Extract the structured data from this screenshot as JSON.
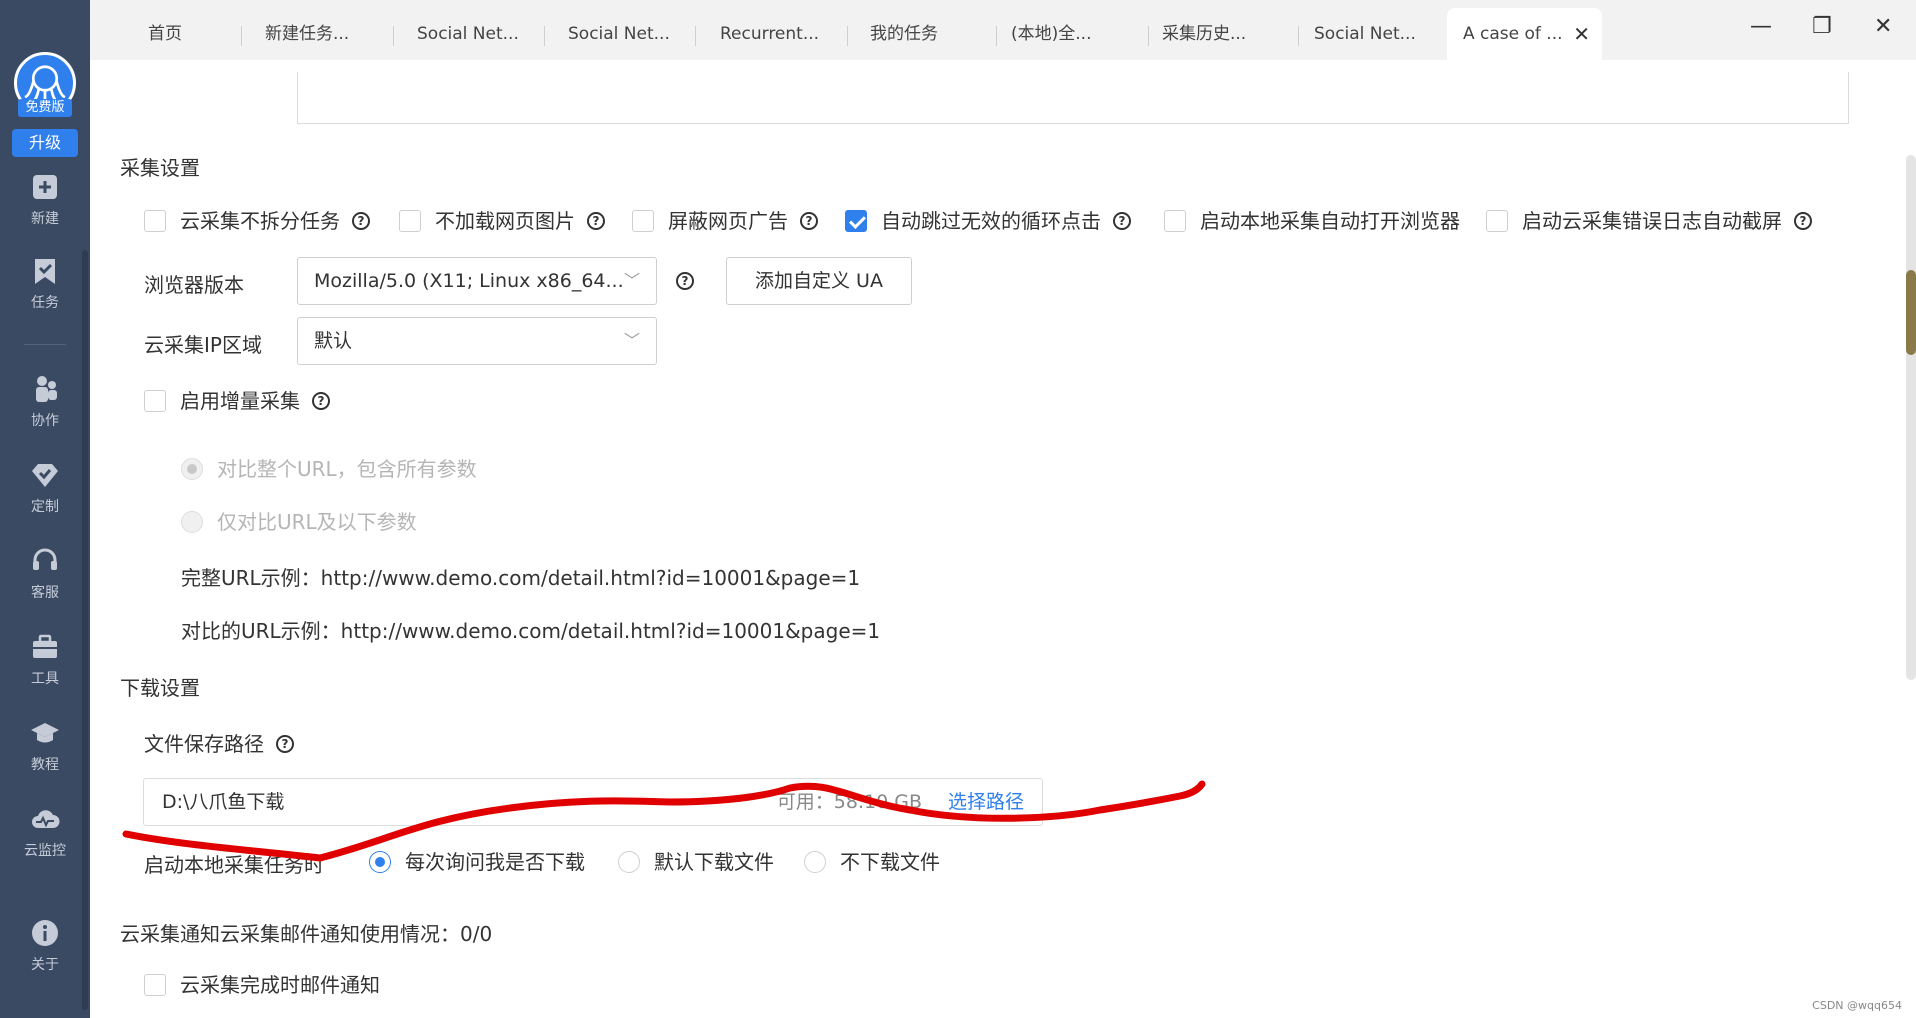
{
  "sidebar": {
    "free_badge": "免费版",
    "upgrade": "升级",
    "items": [
      {
        "label": "新建",
        "icon": "plus-square-icon"
      },
      {
        "label": "任务",
        "icon": "bookmark-check-icon"
      },
      {
        "label": "协作",
        "icon": "users-icon"
      },
      {
        "label": "定制",
        "icon": "diamond-check-icon"
      },
      {
        "label": "客服",
        "icon": "headset-icon"
      },
      {
        "label": "工具",
        "icon": "toolbox-icon"
      },
      {
        "label": "教程",
        "icon": "graduation-cap-icon"
      },
      {
        "label": "云监控",
        "icon": "cloud-pulse-icon"
      },
      {
        "label": "关于",
        "icon": "info-icon"
      }
    ]
  },
  "tabs": [
    {
      "label": "首页"
    },
    {
      "label": "新建任务..."
    },
    {
      "label": "Social Net..."
    },
    {
      "label": "Social Net..."
    },
    {
      "label": "Recurrent..."
    },
    {
      "label": "我的任务"
    },
    {
      "label": "(本地)全..."
    },
    {
      "label": "采集历史..."
    },
    {
      "label": "Social Net..."
    },
    {
      "label": "A case of ..."
    }
  ],
  "collect": {
    "title": "采集设置",
    "options": [
      {
        "label": "云采集不拆分任务",
        "checked": false
      },
      {
        "label": "不加载网页图片",
        "checked": false
      },
      {
        "label": "屏蔽网页广告",
        "checked": false
      },
      {
        "label": "自动跳过无效的循环点击",
        "checked": true
      },
      {
        "label": "启动本地采集自动打开浏览器",
        "checked": false
      },
      {
        "label": "启动云采集错误日志自动截屏",
        "checked": false
      }
    ],
    "browser_label": "浏览器版本",
    "browser_value": "Mozilla/5.0 (X11; Linux x86_64...",
    "add_ua": "添加自定义 UA",
    "ip_label": "云采集IP区域",
    "ip_value": "默认",
    "incremental_label": "启用增量采集",
    "radio_full": "对比整个URL，包含所有参数",
    "radio_partial": "仅对比URL及以下参数",
    "example_full": "完整URL示例：http://www.demo.com/detail.html?id=10001&page=1",
    "example_compare": "对比的URL示例：http://www.demo.com/detail.html?id=10001&page=1"
  },
  "download": {
    "title": "下载设置",
    "path_label": "文件保存路径",
    "path_value": "D:\\八爪鱼下载",
    "available": "可用：58.10 GB",
    "choose": "选择路径",
    "start_label": "启动本地采集任务时",
    "opt_ask": "每次询问我是否下载",
    "opt_default": "默认下载文件",
    "opt_none": "不下载文件"
  },
  "notify": {
    "title": "云采集通知云采集邮件通知使用情况：0/0",
    "email_label": "云采集完成时邮件通知"
  },
  "watermark": "CSDN @wqq654",
  "colors": {
    "accent": "#2f80ed",
    "sidebar": "#3b4a63",
    "annotation": "#e00000"
  }
}
